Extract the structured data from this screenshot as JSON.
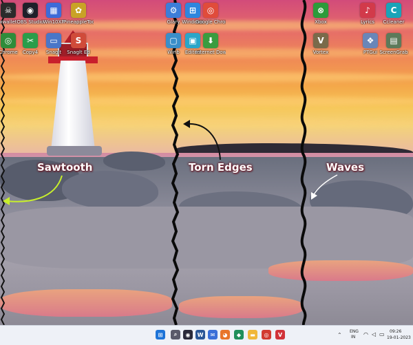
{
  "desktop": {
    "icons_left": [
      {
        "label": "xwallet",
        "icon": "skull-icon",
        "color": "#2b2b2b",
        "glyph": "☠"
      },
      {
        "label": "OBS Studio",
        "icon": "obs-icon",
        "color": "#1f1f2a",
        "glyph": "◉"
      },
      {
        "label": "Win10XP",
        "icon": "package-icon",
        "color": "#3d6bd8",
        "glyph": "▦"
      },
      {
        "label": "PineappleTool",
        "icon": "pineapple-icon",
        "color": "#c9a227",
        "glyph": "✿"
      },
      {
        "label": "Chrome",
        "icon": "chrome-icon",
        "color": "#2f8c3a",
        "glyph": "◎"
      },
      {
        "label": "Copy4",
        "icon": "scissors-icon",
        "color": "#2a9d4a",
        "glyph": "✂"
      },
      {
        "label": "Snaglt",
        "icon": "window-icon",
        "color": "#4a76c8",
        "glyph": "▭"
      },
      {
        "label": "Snaglt Ed",
        "icon": "snagit-icon",
        "color": "#d04b3a",
        "glyph": "S"
      }
    ],
    "icons_middle": [
      {
        "label": "Glary",
        "icon": "tool-icon",
        "color": "#3c7dd9",
        "glyph": "⚙"
      },
      {
        "label": "Windows",
        "icon": "windows-icon",
        "color": "#2e86de",
        "glyph": "⊞"
      },
      {
        "label": "Google Chrome",
        "icon": "chrome-icon",
        "color": "#e04c3b",
        "glyph": "◎"
      },
      {
        "label": "Winb",
        "icon": "window-icon",
        "color": "#3a8ec9",
        "glyph": "▢"
      },
      {
        "label": "Edited",
        "icon": "image-icon",
        "color": "#2aa6c9",
        "glyph": "▣"
      },
      {
        "label": "Internet Downlo...",
        "icon": "globe-icon",
        "color": "#3a9c3f",
        "glyph": "⬇"
      }
    ],
    "icons_right": [
      {
        "label": "Xbox",
        "icon": "xbox-icon",
        "color": "#2c9b3a",
        "glyph": "⊗"
      },
      {
        "label": "Vortex",
        "icon": "vortex-icon",
        "color": "#7a6a4a",
        "glyph": "V"
      },
      {
        "label": "Lyrics",
        "icon": "music-icon",
        "color": "#d23a4a",
        "glyph": "♪"
      },
      {
        "label": "Ccleaner",
        "icon": "ccleaner-icon",
        "color": "#1aa3b8",
        "glyph": "C"
      },
      {
        "label": "PTGui",
        "icon": "gear-icon",
        "color": "#6a86b8",
        "glyph": "❖"
      },
      {
        "label": "ScreenGrab",
        "icon": "map-icon",
        "color": "#5d7a5a",
        "glyph": "▤"
      }
    ]
  },
  "annotations": {
    "sawtooth": "Sawtooth",
    "torn_edges": "Torn Edges",
    "waves": "Waves"
  },
  "taskbar": {
    "apps": [
      {
        "icon": "windows-start-icon",
        "color": "#1e74d8",
        "glyph": "⊞"
      },
      {
        "icon": "search-icon",
        "color": "#5a5a6a",
        "glyph": "⌕"
      },
      {
        "icon": "camera-icon",
        "color": "#2a2a3a",
        "glyph": "◉"
      },
      {
        "icon": "word-icon",
        "color": "#2b5797",
        "glyph": "W"
      },
      {
        "icon": "chat-icon",
        "color": "#3a6fd8",
        "glyph": "✉"
      },
      {
        "icon": "firefox-icon",
        "color": "#e8752a",
        "glyph": "◕"
      },
      {
        "icon": "store-icon",
        "color": "#1f8f5a",
        "glyph": "◆"
      },
      {
        "icon": "explorer-icon",
        "color": "#f0b73a",
        "glyph": "▬"
      },
      {
        "icon": "chrome-icon",
        "color": "#d23a30",
        "glyph": "◎"
      },
      {
        "icon": "vivaldi-icon",
        "color": "#d1333a",
        "glyph": "V"
      }
    ],
    "tray": {
      "language_top": "ENG",
      "language_bottom": "IN",
      "time": "09:26",
      "date": "19-01-2023"
    }
  }
}
